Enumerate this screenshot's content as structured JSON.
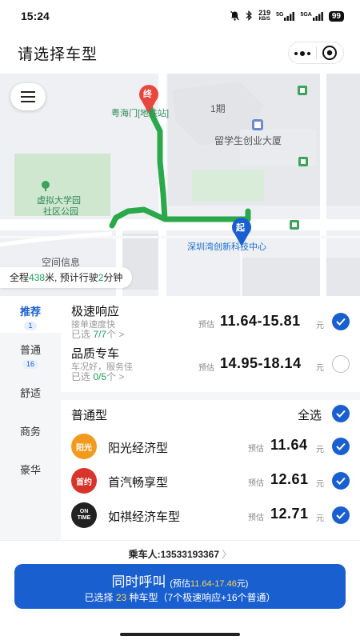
{
  "status": {
    "time": "15:24",
    "net_speed_value": "219",
    "net_speed_unit": "KB/S",
    "signal1": "5G",
    "signal2": "5GA",
    "battery": "99"
  },
  "header": {
    "title": "请选择车型"
  },
  "map": {
    "labels": {
      "end_marker": "终",
      "start_marker": "起",
      "station": "粤海门[地铁站]",
      "phase": "1期",
      "building": "留学生创业大厦",
      "park_line1": "虚拟大学园",
      "park_line2": "社区公园",
      "space_info": "空间信息",
      "tech_center": "深圳湾创新科技中心"
    },
    "route_info": {
      "prefix": "全程",
      "distance": "438",
      "mid": "米, 预计行驶",
      "minutes": "2",
      "suffix": "分钟"
    }
  },
  "side_nav": {
    "items": [
      {
        "label": "推荐",
        "count": "1"
      },
      {
        "label": "普通",
        "count": "16"
      },
      {
        "label": "舒适"
      },
      {
        "label": "商务"
      },
      {
        "label": "豪华"
      }
    ]
  },
  "cars": {
    "express": {
      "name": "极速响应",
      "desc": "接单速度快",
      "selected_prefix": "已选",
      "selected_count": "7/7",
      "selected_suffix": "个 >",
      "est_label": "预估",
      "price": "11.64-15.81",
      "unit": "元"
    },
    "premium": {
      "name": "品质专车",
      "desc": "车况好，服务佳",
      "selected_prefix": "已选",
      "selected_count": "0/5",
      "selected_suffix": "个 >",
      "est_label": "预估",
      "price": "14.95-18.14",
      "unit": "元"
    }
  },
  "normal_group": {
    "title": "普通型",
    "select_all": "全选",
    "items": [
      {
        "logo": "阳光",
        "name": "阳光经济型",
        "est_label": "预估",
        "price": "11.64",
        "unit": "元",
        "logo_color": "#f39a1e"
      },
      {
        "logo": "首约",
        "name": "首汽畅享型",
        "est_label": "预估",
        "price": "12.61",
        "unit": "元",
        "logo_color": "#d9342b"
      },
      {
        "logo": "ON TIME",
        "name": "如祺经济车型",
        "est_label": "预估",
        "price": "12.71",
        "unit": "元",
        "logo_color": "#222222"
      }
    ]
  },
  "footer": {
    "passenger_label": "乘车人:",
    "passenger_phone": "13533193367",
    "call_label": "同时呼叫",
    "call_est_prefix": "(预估",
    "call_est_range": "11.64-17.46",
    "call_est_suffix": "元)",
    "selected_prefix": "已选择",
    "selected_count": "23",
    "selected_suffix": "种车型（7个极速响应+16个普通）"
  },
  "colors": {
    "primary": "#1a5fd0",
    "route": "#2aa84a",
    "highlight": "#1aa260"
  }
}
